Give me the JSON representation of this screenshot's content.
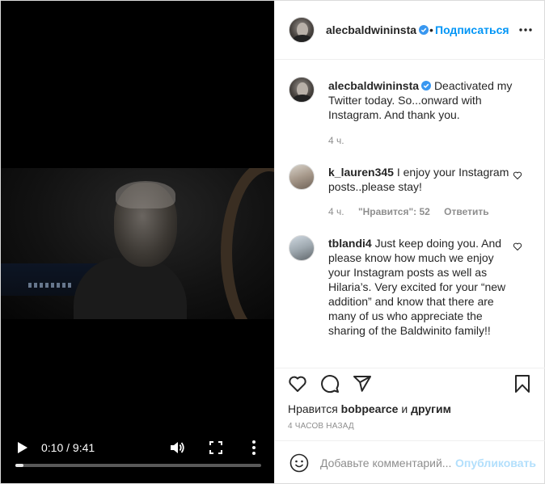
{
  "video": {
    "time_display": "0:10 / 9:41",
    "progress_fraction": 0.033
  },
  "header": {
    "username": "alecbaldwininsta",
    "dot": "•",
    "follow_label": "Подписаться"
  },
  "caption": {
    "username": "alecbaldwininsta",
    "text": "Deactivated my Twitter today. So...onward with Instagram. And thank you.",
    "time": "4 ч."
  },
  "comments": [
    {
      "username": "k_lauren345",
      "text": "I enjoy your Instagram posts..please stay!",
      "time": "4 ч.",
      "likes": "\"Нравится\": 52",
      "reply_label": "Ответить"
    },
    {
      "username": "tblandi4",
      "text": "Just keep doing you. And please know how much we enjoy your Instagram posts as well as Hilaria’s. Very excited for your “new addition” and know that there are many of us who appreciate the sharing of the Baldwinito family!!"
    }
  ],
  "likes": {
    "prefix": "Нравится",
    "user": "bobpearce",
    "conj": "и",
    "others": "другим"
  },
  "posted": "4 ЧАСОВ НАЗАД",
  "add_comment": {
    "placeholder": "Добавьте комментарий...",
    "publish_label": "Опубликовать"
  },
  "colors": {
    "accent": "#0095f6",
    "publish_disabled": "#b2dffc",
    "muted": "#8e8e8e"
  },
  "icons": [
    "play-icon",
    "volume-icon",
    "fullscreen-icon",
    "more-vertical-icon",
    "verified-icon",
    "more-horizontal-icon",
    "heart-icon",
    "comment-icon",
    "share-icon",
    "bookmark-icon",
    "emoji-icon"
  ]
}
